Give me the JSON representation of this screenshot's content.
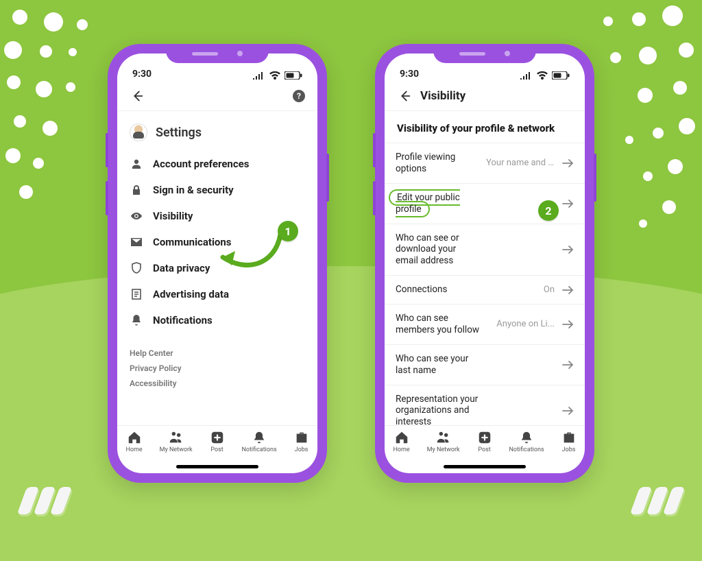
{
  "statusbar": {
    "time": "9:30"
  },
  "phone1": {
    "page_title": "Settings",
    "help_label": "?",
    "menu": [
      {
        "icon": "user-icon",
        "label": "Account preferences"
      },
      {
        "icon": "lock-icon",
        "label": "Sign in & security"
      },
      {
        "icon": "eye-icon",
        "label": "Visibility"
      },
      {
        "icon": "envelope-icon",
        "label": "Communications"
      },
      {
        "icon": "shield-icon",
        "label": "Data privacy"
      },
      {
        "icon": "document-icon",
        "label": "Advertising data"
      },
      {
        "icon": "bell-icon",
        "label": "Notifications"
      }
    ],
    "footer_links": [
      "Help Center",
      "Privacy Policy",
      "Accessibility"
    ]
  },
  "phone2": {
    "page_title": "Visibility",
    "section_title": "Visibility of your profile & network",
    "items": [
      {
        "label": "Profile viewing options",
        "value": "Your name and he..."
      },
      {
        "label": "Edit your public profile",
        "value": ""
      },
      {
        "label": "Who can see or download your email address",
        "value": ""
      },
      {
        "label": "Connections",
        "value": "On"
      },
      {
        "label": "Who can see members you follow",
        "value": "Anyone on Li..."
      },
      {
        "label": "Who can see your last name",
        "value": ""
      },
      {
        "label": "Representation your organizations and interests",
        "value": ""
      }
    ]
  },
  "tabs": [
    {
      "icon": "home-icon",
      "label": "Home"
    },
    {
      "icon": "network-icon",
      "label": "My Network"
    },
    {
      "icon": "post-icon",
      "label": "Post"
    },
    {
      "icon": "bell-icon",
      "label": "Notifications"
    },
    {
      "icon": "jobs-icon",
      "label": "Jobs"
    }
  ],
  "annotations": {
    "step1": "1",
    "step2": "2"
  },
  "colors": {
    "bg": "#8dc63f",
    "phone": "#9b51e0",
    "accent": "#5aab1e"
  }
}
